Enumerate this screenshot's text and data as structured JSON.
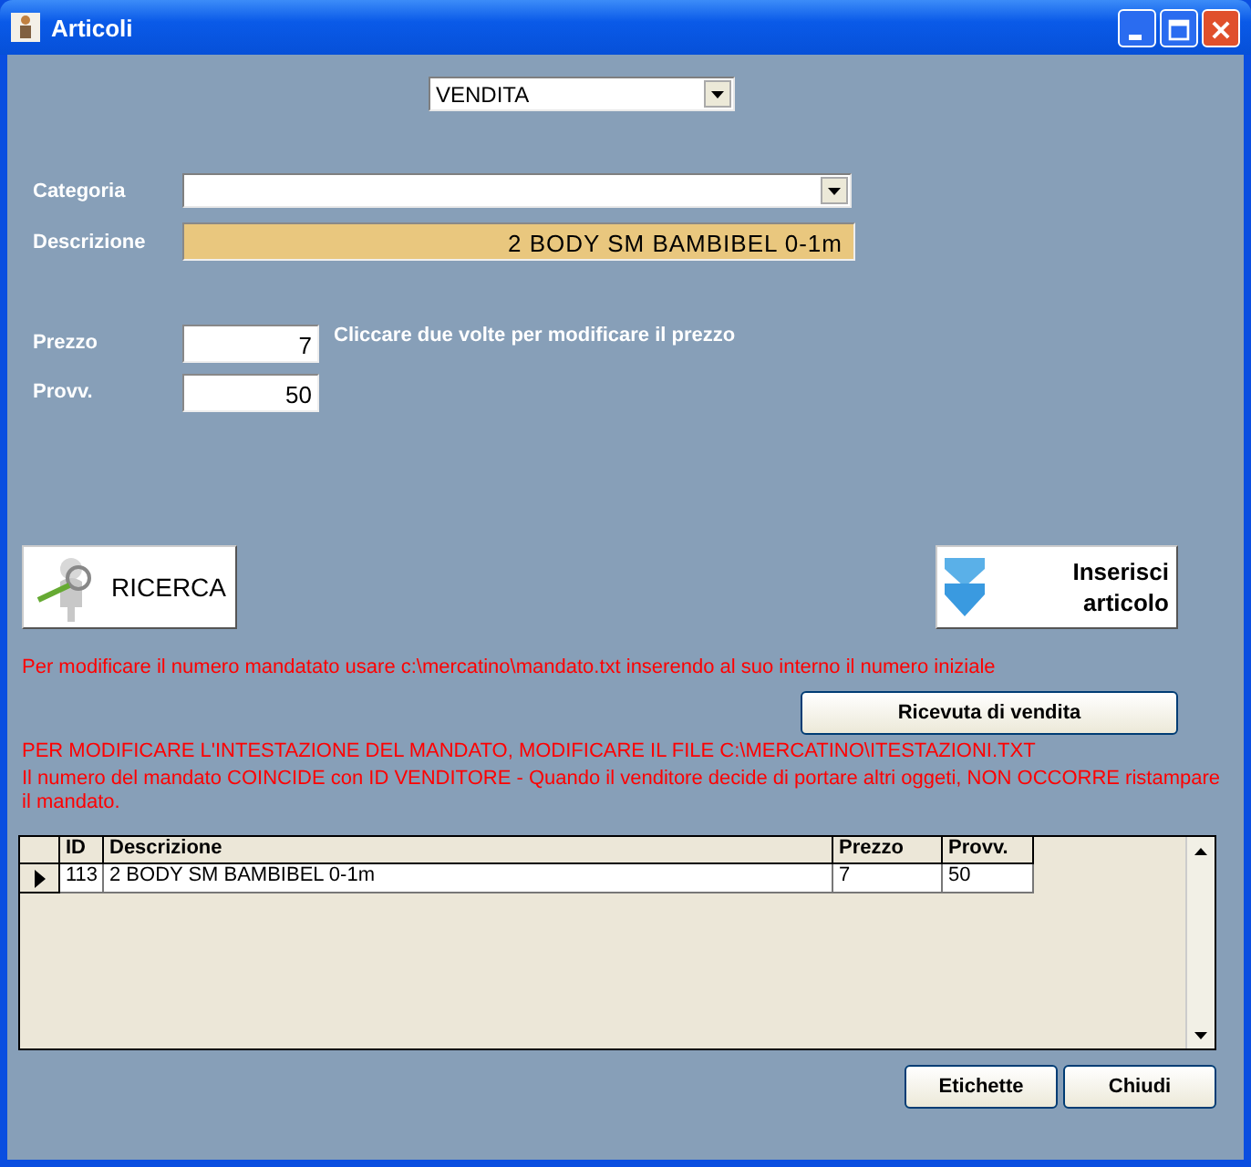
{
  "window": {
    "title": "Articoli"
  },
  "mode_dropdown": {
    "value": "VENDITA"
  },
  "fields": [
    {
      "label": "Categoria",
      "kind": "combo"
    },
    {
      "label": "Descrizione",
      "kind": "readonly",
      "value": "2 BODY SM BAMBIBEL 0-1m"
    }
  ],
  "price_fields": [
    {
      "label": "Prezzo",
      "value": "7",
      "hint": "Cliccare due volte per modificare il prezzo"
    },
    {
      "label": "Provv.",
      "value": "50"
    }
  ],
  "search_button": {
    "label": "RICERCA"
  },
  "insert_button": {
    "label": "Inserisci articolo"
  },
  "note_1": "Per modificare il numero mandatato usare c:\\mercatino\\mandato.txt inserendo al suo interno il numero iniziale",
  "receipt_button": {
    "label": "Ricevuta di vendita"
  },
  "note_2": "PER MODIFICARE L'INTESTAZIONE DEL MANDATO, MODIFICARE IL FILE C:\\MERCATINO\\ITESTAZIONI.TXT",
  "note_3": "Il numero del mandato COINCIDE con ID VENDITORE - Quando il venditore decide di portare altri oggeti, NON OCCORRE ristampare il mandato.",
  "table": {
    "columns": [
      "ID",
      "Descrizione",
      "Prezzo",
      "Provv."
    ],
    "rows": [
      {
        "cells": [
          "113",
          "2 BODY SM BAMBIBEL 0-1m",
          "7",
          "50"
        ],
        "selected": true
      }
    ]
  },
  "footer_buttons": [
    "Etichette",
    "Chiudi"
  ]
}
